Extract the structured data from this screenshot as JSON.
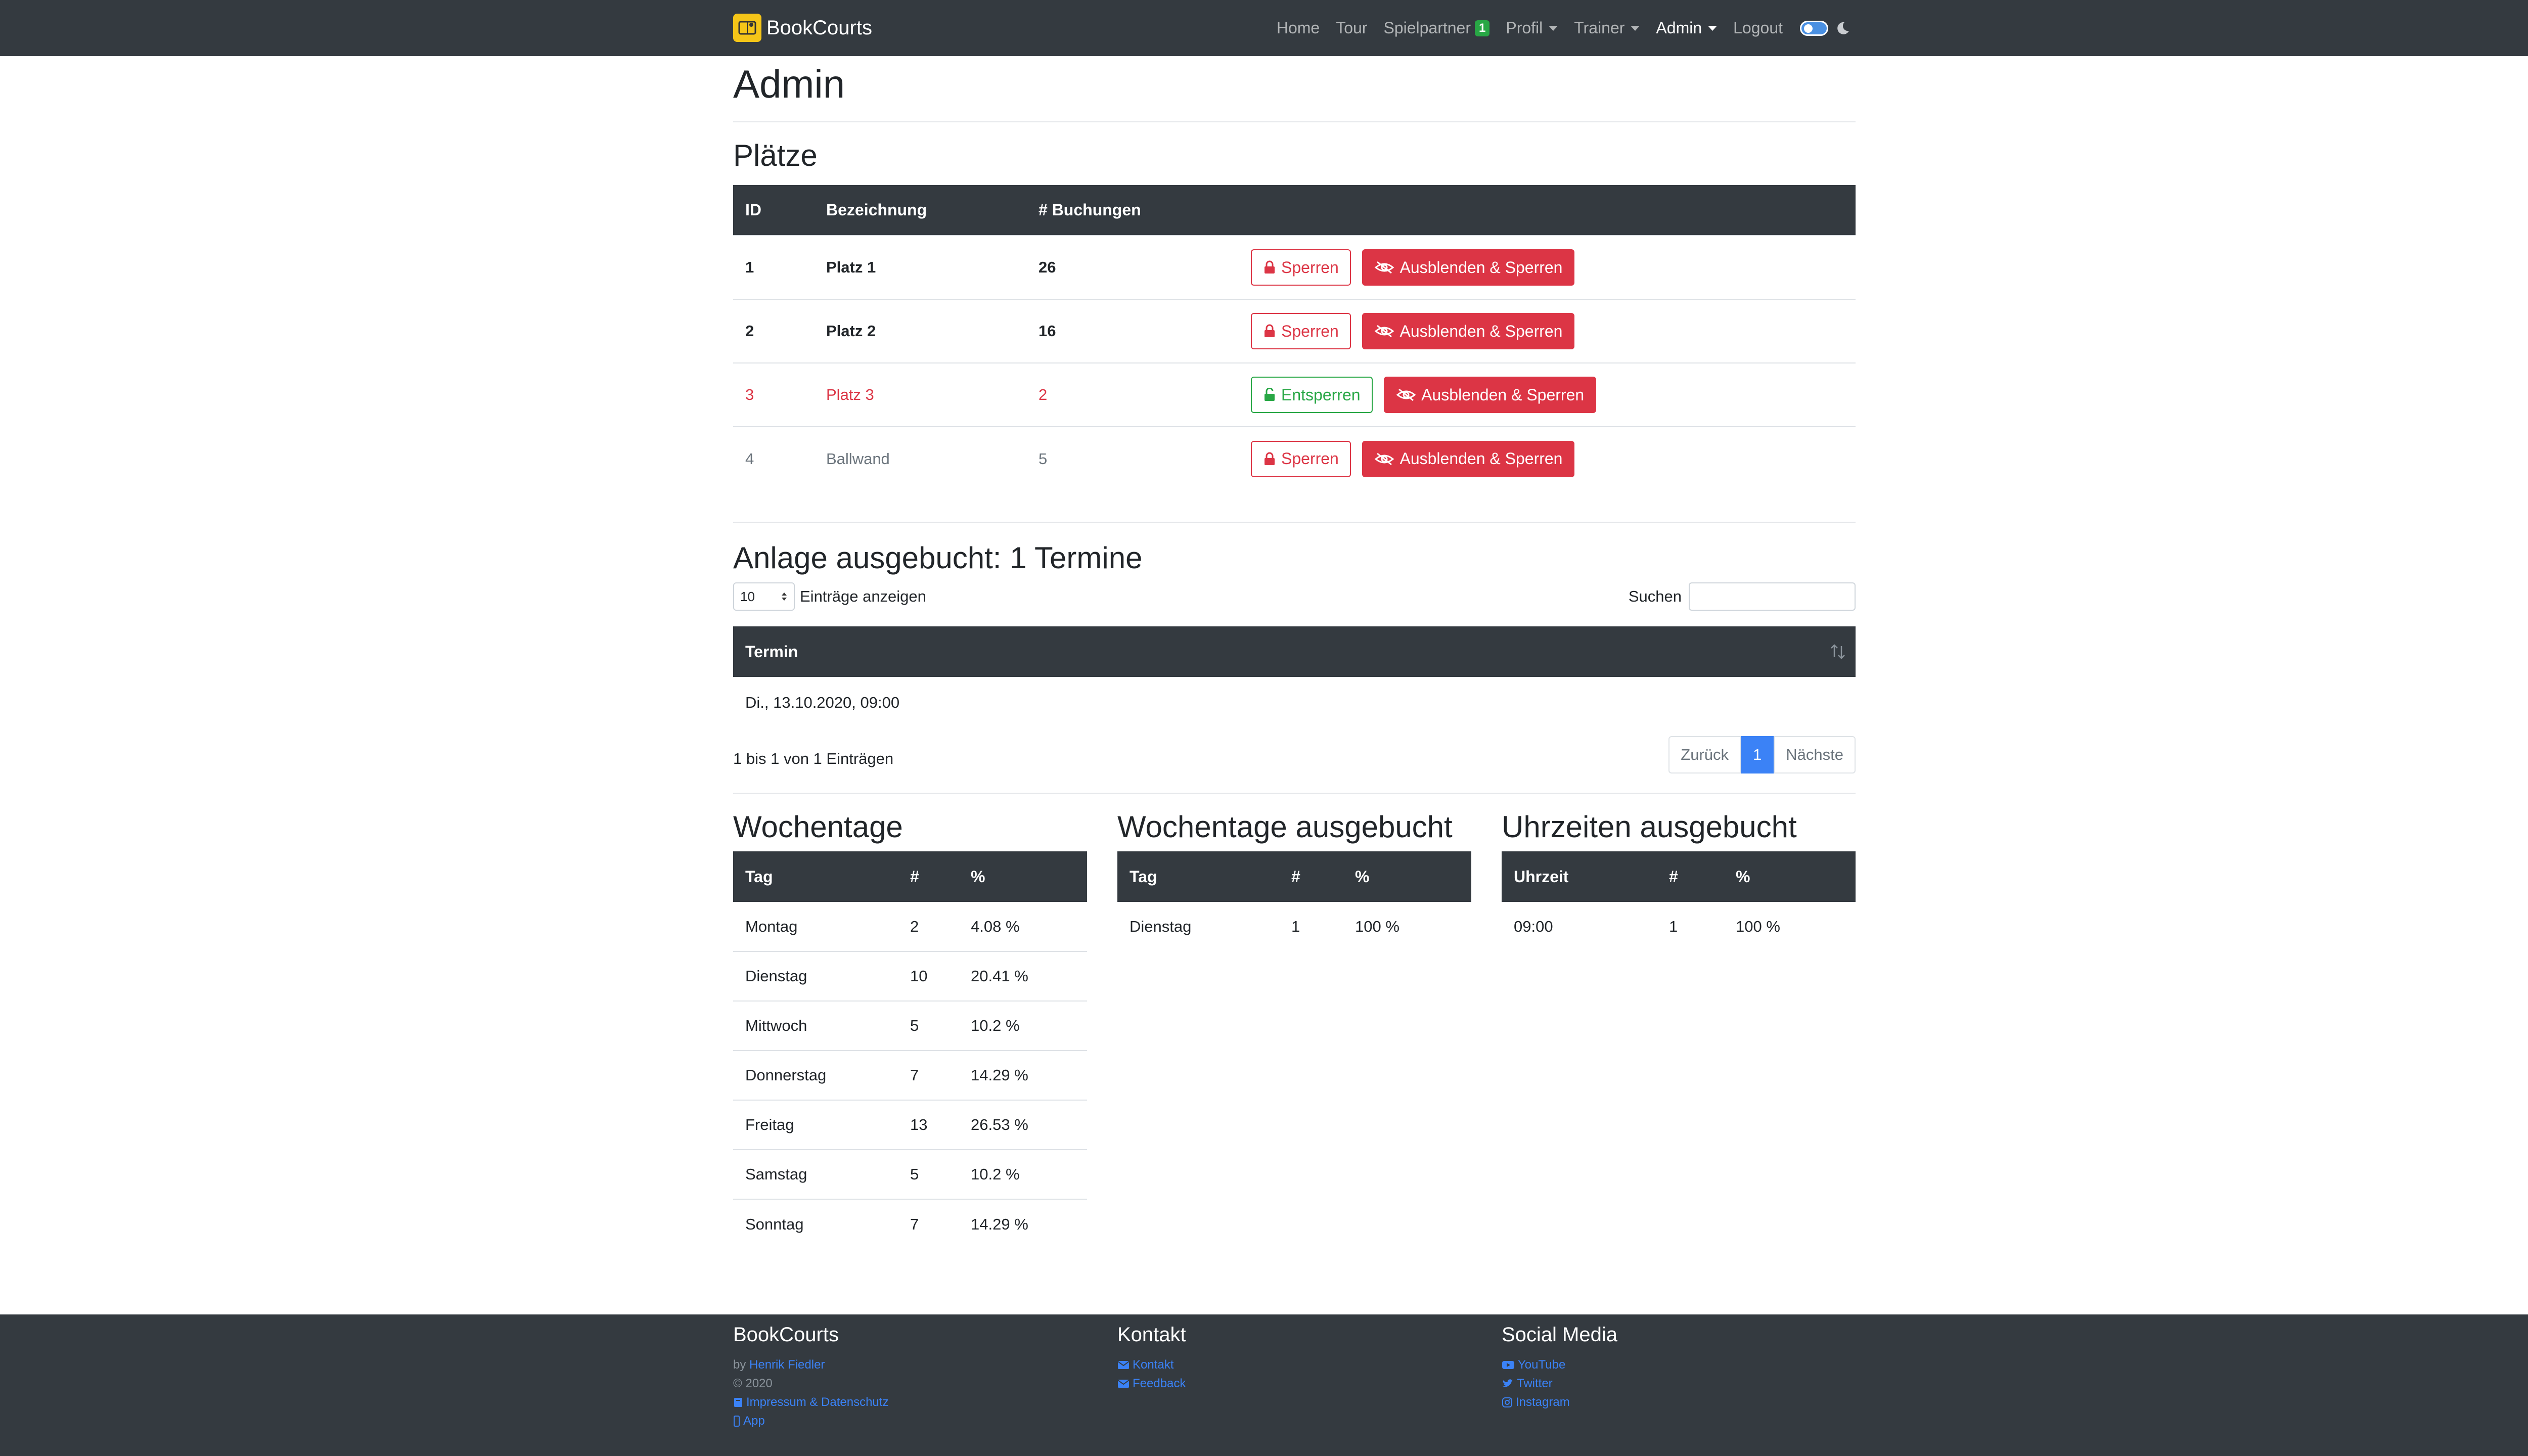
{
  "navbar": {
    "brand": "BookCourts",
    "links": {
      "home": "Home",
      "tour": "Tour",
      "spielpartner": "Spielpartner",
      "spielpartner_badge": "1",
      "profil": "Profil",
      "trainer": "Trainer",
      "admin": "Admin",
      "logout": "Logout"
    }
  },
  "page": {
    "title": "Admin"
  },
  "courts": {
    "title": "Plätze",
    "headers": {
      "id": "ID",
      "name": "Bezeichnung",
      "bookings": "# Buchungen"
    },
    "rows": [
      {
        "id": "1",
        "name": "Platz 1",
        "bookings": "26",
        "lock_label": "Sperren",
        "hide_label": "Ausblenden & Sperren"
      },
      {
        "id": "2",
        "name": "Platz 2",
        "bookings": "16",
        "lock_label": "Sperren",
        "hide_label": "Ausblenden & Sperren"
      },
      {
        "id": "3",
        "name": "Platz 3",
        "bookings": "2",
        "lock_label": "Entsperren",
        "hide_label": "Ausblenden & Sperren"
      },
      {
        "id": "4",
        "name": "Ballwand",
        "bookings": "5",
        "lock_label": "Sperren",
        "hide_label": "Ausblenden & Sperren"
      }
    ]
  },
  "booked_out": {
    "title": "Anlage ausgebucht: 1 Termine",
    "length_value": "10",
    "length_label": "Einträge anzeigen",
    "search_label": "Suchen",
    "search_value": "",
    "header": "Termin",
    "rows": [
      "Di., 13.10.2020, 09:00"
    ],
    "info": "1 bis 1 von 1 Einträgen",
    "pagination": {
      "prev": "Zurück",
      "current": "1",
      "next": "Nächste"
    }
  },
  "weekdays": {
    "title": "Wochentage",
    "headers": [
      "Tag",
      "#",
      "%"
    ],
    "rows": [
      [
        "Montag",
        "2",
        "4.08 %"
      ],
      [
        "Dienstag",
        "10",
        "20.41 %"
      ],
      [
        "Mittwoch",
        "5",
        "10.2 %"
      ],
      [
        "Donnerstag",
        "7",
        "14.29 %"
      ],
      [
        "Freitag",
        "13",
        "26.53 %"
      ],
      [
        "Samstag",
        "5",
        "10.2 %"
      ],
      [
        "Sonntag",
        "7",
        "14.29 %"
      ]
    ]
  },
  "weekdays_booked": {
    "title": "Wochentage ausgebucht",
    "headers": [
      "Tag",
      "#",
      "%"
    ],
    "rows": [
      [
        "Dienstag",
        "1",
        "100 %"
      ]
    ]
  },
  "hours_booked": {
    "title": "Uhrzeiten ausgebucht",
    "headers": [
      "Uhrzeit",
      "#",
      "%"
    ],
    "rows": [
      [
        "09:00",
        "1",
        "100 %"
      ]
    ]
  },
  "footer": {
    "col1": {
      "title": "BookCourts",
      "by": "by",
      "author": "Henrik Fiedler",
      "copyright": "© 2020",
      "imprint": "Impressum & Datenschutz",
      "app": "App"
    },
    "col2": {
      "title": "Kontakt",
      "contact": "Kontakt",
      "feedback": "Feedback"
    },
    "col3": {
      "title": "Social Media",
      "youtube": "YouTube",
      "twitter": "Twitter",
      "instagram": "Instagram"
    }
  },
  "colors": {
    "navbar_bg": "#343a40",
    "danger": "#dc3545",
    "success": "#28a745",
    "primary": "#3b82f6",
    "brand_yellow": "#f5c518"
  }
}
